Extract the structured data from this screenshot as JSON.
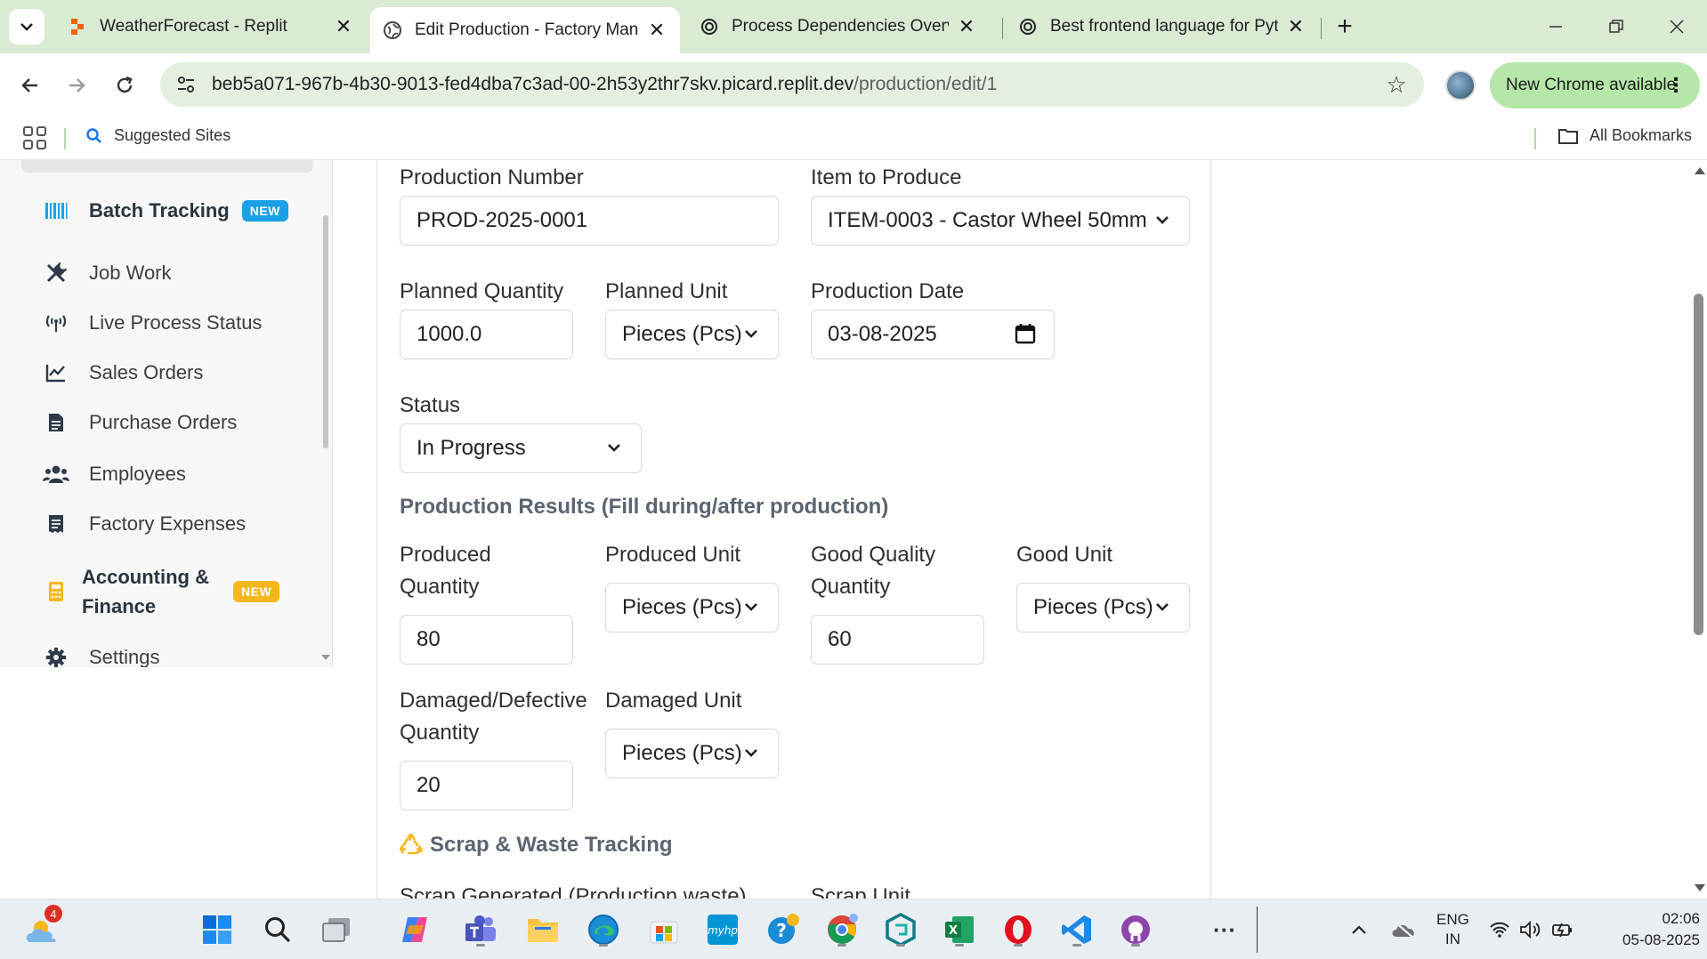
{
  "browser": {
    "tabs": [
      {
        "title": "WeatherForecast - Replit",
        "active": false,
        "icon": "replit-icon"
      },
      {
        "title": "Edit Production - Factory Management",
        "active": true,
        "icon": "globe-icon"
      },
      {
        "title": "Process Dependencies Overview",
        "active": false,
        "icon": "chatgpt-icon"
      },
      {
        "title": "Best frontend language for Python",
        "active": false,
        "icon": "chatgpt-icon"
      }
    ],
    "url_host": "beb5a071-967b-4b30-9013-fed4dba7c3ad-00-2h53y2thr7skv.picard.replit.dev",
    "url_path": "/production/edit/1",
    "new_chrome_label": "New Chrome available",
    "bookmarks": {
      "suggested_sites": "Suggested Sites",
      "all_bookmarks": "All Bookmarks"
    }
  },
  "sidebar": {
    "items": [
      {
        "label": "Batch Tracking",
        "icon": "barcode-icon",
        "badge": "NEW",
        "bold": true
      },
      {
        "label": "Job Work",
        "icon": "tools-icon"
      },
      {
        "label": "Live Process Status",
        "icon": "broadcast-icon"
      },
      {
        "label": "Sales Orders",
        "icon": "chart-line-icon"
      },
      {
        "label": "Purchase Orders",
        "icon": "document-icon"
      },
      {
        "label": "Employees",
        "icon": "users-icon"
      },
      {
        "label": "Factory Expenses",
        "icon": "receipt-icon"
      },
      {
        "label_line1": "Accounting &",
        "label_line2": "Finance",
        "icon": "calculator-icon",
        "badge": "NEW",
        "bold": true
      },
      {
        "label": "Settings",
        "icon": "gear-icon"
      }
    ]
  },
  "form": {
    "production_number": {
      "label": "Production Number",
      "value": "PROD-2025-0001"
    },
    "item_to_produce": {
      "label": "Item to Produce",
      "value": "ITEM-0003 - Castor Wheel 50mm"
    },
    "planned_quantity": {
      "label": "Planned Quantity",
      "value": "1000.0"
    },
    "planned_unit": {
      "label": "Planned Unit",
      "value": "Pieces (Pcs)"
    },
    "production_date": {
      "label": "Production Date",
      "value": "03-08-2025"
    },
    "status": {
      "label": "Status",
      "value": "In Progress"
    },
    "results_title": "Production Results (Fill during/after production)",
    "produced_quantity": {
      "label_line1": "Produced",
      "label_line2": "Quantity",
      "value": "80"
    },
    "produced_unit": {
      "label": "Produced Unit",
      "value": "Pieces (Pcs)"
    },
    "good_quality_quantity": {
      "label_line1": "Good Quality",
      "label_line2": "Quantity",
      "value": "60"
    },
    "good_unit": {
      "label": "Good Unit",
      "value": "Pieces (Pcs)"
    },
    "damaged_quantity": {
      "label_line1": "Damaged/Defective",
      "label_line2": "Quantity",
      "value": "20"
    },
    "damaged_unit": {
      "label": "Damaged Unit",
      "value": "Pieces (Pcs)"
    },
    "scrap_title": "Scrap & Waste Tracking",
    "scrap_generated_label": "Scrap Generated (Production waste)",
    "scrap_unit_label": "Scrap Unit"
  },
  "taskbar": {
    "weather_badge": "4",
    "language_line1": "ENG",
    "language_line2": "IN",
    "time": "02:06",
    "date": "05-08-2025"
  },
  "colors": {
    "tab_strip": "#d9ebd3",
    "badge_blue": "#1aa0e8",
    "badge_yellow": "#f6b71c",
    "new_chrome": "#b5e7a9"
  }
}
